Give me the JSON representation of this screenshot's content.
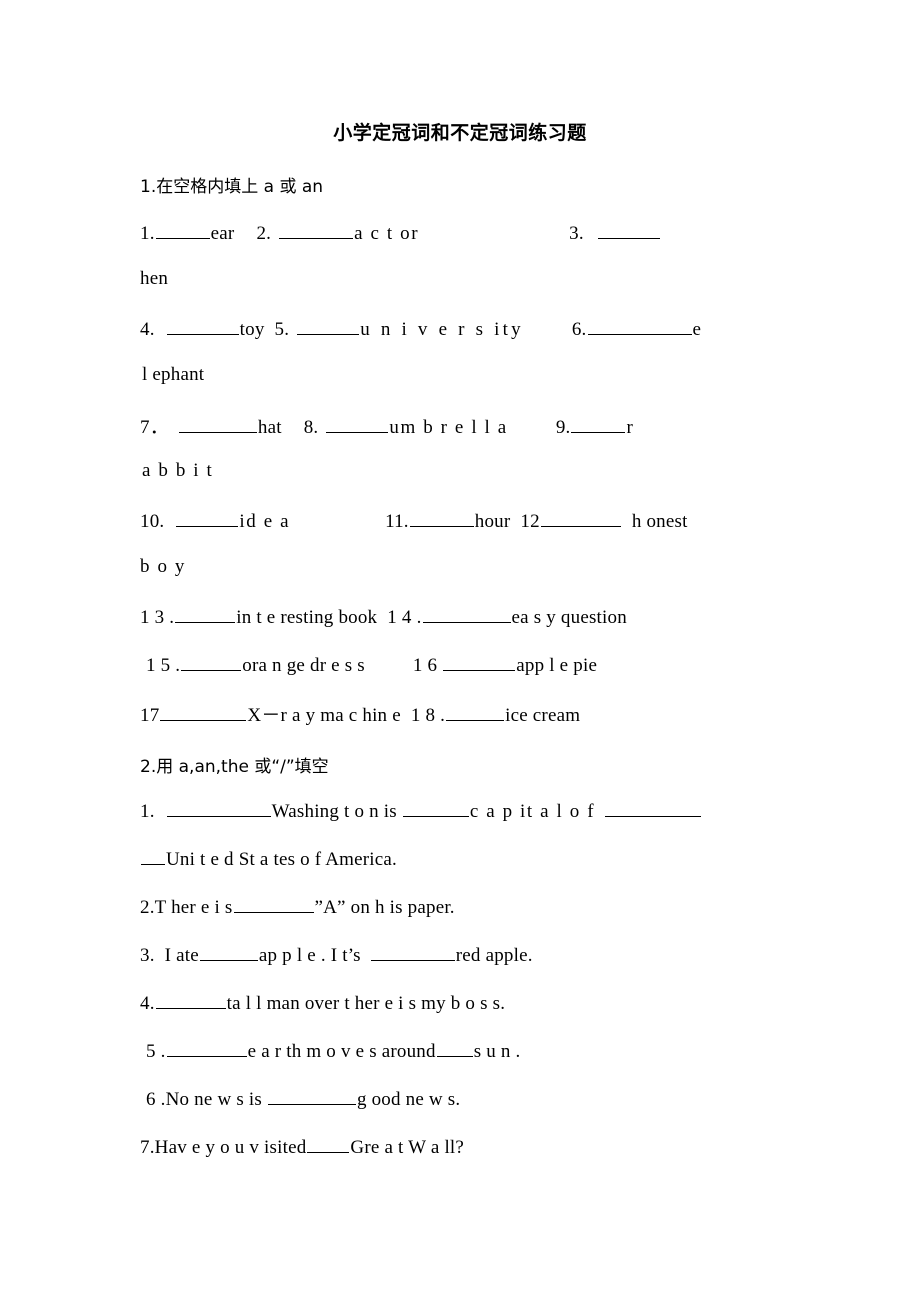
{
  "document": {
    "title": "小学定冠词和不定冠词练习题"
  },
  "sections": [
    {
      "id": "section-1",
      "heading": "1.在空格内填上 a 或 an",
      "heading_number": "1.",
      "heading_text_cn": "在空格内填上",
      "heading_text_en": "a 或 an",
      "items": [
        {
          "num": "1.",
          "word": "ear"
        },
        {
          "num": "2.",
          "word": "a c t or"
        },
        {
          "num": "3.",
          "word": "hen"
        },
        {
          "num": "4.",
          "word": "toy"
        },
        {
          "num": "5.",
          "word": "u n i v e r s ity"
        },
        {
          "num": "6.",
          "word": "e l ephant"
        },
        {
          "num": "7.",
          "word": "hat"
        },
        {
          "num": "8.",
          "word": "um b r e l l a"
        },
        {
          "num": "9.",
          "word": "r a b b i t"
        },
        {
          "num": "10.",
          "word": "id e a"
        },
        {
          "num": "11.",
          "word": "hour"
        },
        {
          "num": "12",
          "word": "h onest b o y"
        },
        {
          "num": "13.",
          "word": "in t e resting book"
        },
        {
          "num": "14.",
          "word": "ea s y  question"
        },
        {
          "num": "15.",
          "word": "ora n ge dr e s s"
        },
        {
          "num": "16",
          "word": "app l e  pie"
        },
        {
          "num": "17",
          "word": "X－r a y  ma c hin e"
        },
        {
          "num": "18.",
          "word": "ice cream"
        }
      ]
    },
    {
      "id": "section-2",
      "heading": "2.用 a,an,the 或“/”填空",
      "heading_number": "2.",
      "heading_text_cn_a": "用",
      "heading_text_en": "a,an,the",
      "heading_text_cn_b": "或“/”填空",
      "items": [
        {
          "num": "1.",
          "text": "Washing t o n is ___ c a p it a l  o f ___ Uni t e d St a tes o f  America."
        },
        {
          "num": "2.",
          "text": "T her e  i s ___”A”  on  h is paper."
        },
        {
          "num": "3.",
          "text": "I ate ___ ap p l e . I t’s ___ red apple."
        },
        {
          "num": "4.",
          "text": "___ ta l l  man over  t her e  i s  my  b o s s."
        },
        {
          "num": "5.",
          "text": "___ e a r th m o v e s  around___ s u n ."
        },
        {
          "num": "6.",
          "text": "No ne w s  is ___ g ood ne w s."
        },
        {
          "num": "7.",
          "text": "Hav e  y o u  v isited___ Gre a t  W a ll?"
        }
      ]
    }
  ],
  "lines": {
    "l1_n1": "1.",
    "l1_w1": "ear",
    "l1_n2": "2.",
    "l1_w2": "a c t or",
    "l1_n3": "3.",
    "l2_w3": "hen",
    "l3_n4": "4.",
    "l3_w4": "toy",
    "l3_n5": "5.",
    "l3_w5": "u n i v e r s ity",
    "l3_n6": "6.",
    "l3_w6a": "e",
    "l4_w6b": "l ephant",
    "l5_n7": "7．",
    "l5_w7": "hat",
    "l5_n8": "8.",
    "l5_w8": "um b r e l l a",
    "l5_n9": "9.",
    "l5_w9a": "r",
    "l6_w9b": "a b b i t",
    "l7_n10": "10.",
    "l7_w10": "id e a",
    "l7_n11": "11.",
    "l7_w11": "hour",
    "l7_n12": "12",
    "l7_w12a": "h onest",
    "l8_w12b": "b o y",
    "l9_n13": "1 3 .",
    "l9_w13": "in t  e resting book",
    "l9_n14": "1 4 .",
    "l9_w14": "ea s  y  question",
    "l10_n15": "1 5 .",
    "l10_w15": "ora n ge dr e  s s",
    "l10_n16": "1 6",
    "l10_w16": "app l  e  pie",
    "l11_n17": "17",
    "l11_w17": "X－r a  y  ma c hin e",
    "l11_n18": "1 8 .",
    "l11_w18": "ice cream",
    "s2_q1_n": "1.",
    "s2_q1_a": "Washing t  o n is",
    "s2_q1_b": "c a p it a l   o f",
    "s2_q1_c": "Uni t  e d St a tes o f  America.",
    "s2_q2_n": "2.",
    "s2_q2_a": "T her e   i s",
    "s2_q2_b": "”A”  on  h is paper.",
    "s2_q3_n": "3.",
    "s2_q3_a": "I ate",
    "s2_q3_b": "ap p l  e . I t’s",
    "s2_q3_c": "red apple.",
    "s2_q4_n": "4.",
    "s2_q4_a": "ta l  l  man over  t her e  i s  my  b o s s.",
    "s2_q5_n": "5 .",
    "s2_q5_a": "e a  r th m o v e s  around",
    "s2_q5_b": "s u n .",
    "s2_q6_n": "6 .",
    "s2_q6_a": "No ne w s   is",
    "s2_q6_b": "g ood ne w s.",
    "s2_q7_n": "7.",
    "s2_q7_a": "Hav e  y o u   v isited",
    "s2_q7_b": "Gre a t  W a ll?"
  }
}
